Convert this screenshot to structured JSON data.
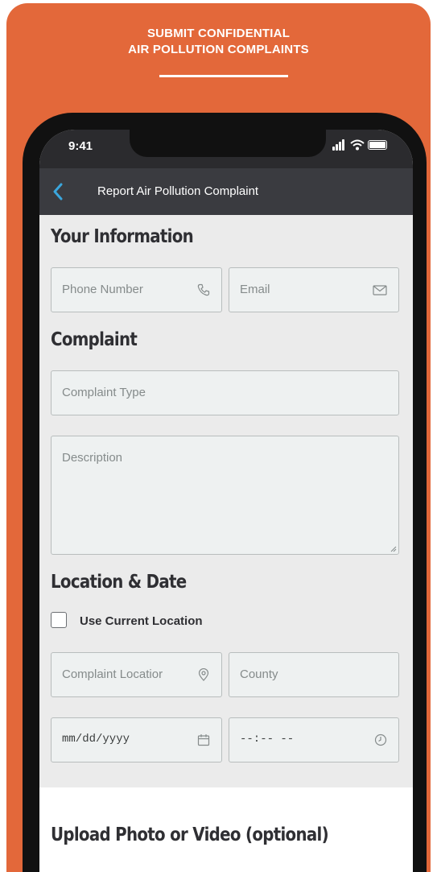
{
  "promo": {
    "title_line1": "SUBMIT CONFIDENTIAL",
    "title_line2": "AIR POLLUTION COMPLAINTS"
  },
  "status_bar": {
    "time": "9:41"
  },
  "nav": {
    "title": "Report Air Pollution Complaint"
  },
  "sections": {
    "your_information": "Your Information",
    "complaint": "Complaint",
    "location_date": "Location & Date",
    "upload": "Upload Photo or Video (optional)"
  },
  "fields": {
    "phone": {
      "placeholder": "Phone Number",
      "icon": "phone-icon"
    },
    "email": {
      "placeholder": "Email",
      "icon": "mail-icon"
    },
    "complaint_type": {
      "placeholder": "Complaint Type"
    },
    "description": {
      "placeholder": "Description"
    },
    "location": {
      "placeholder": "Complaint Locatior",
      "icon": "location-pin-icon"
    },
    "county": {
      "placeholder": "County"
    },
    "date": {
      "placeholder": "mm/dd/yyyy",
      "icon": "calendar-icon"
    },
    "time": {
      "placeholder": "--:-- --",
      "icon": "clock-icon"
    }
  },
  "use_current_location": {
    "label": "Use Current Location",
    "checked": false
  },
  "colors": {
    "brand_orange": "#e3683a",
    "nav_bg": "#3a3b40",
    "back_arrow": "#3aa6dd",
    "upload_button": "#2b7d5e"
  }
}
